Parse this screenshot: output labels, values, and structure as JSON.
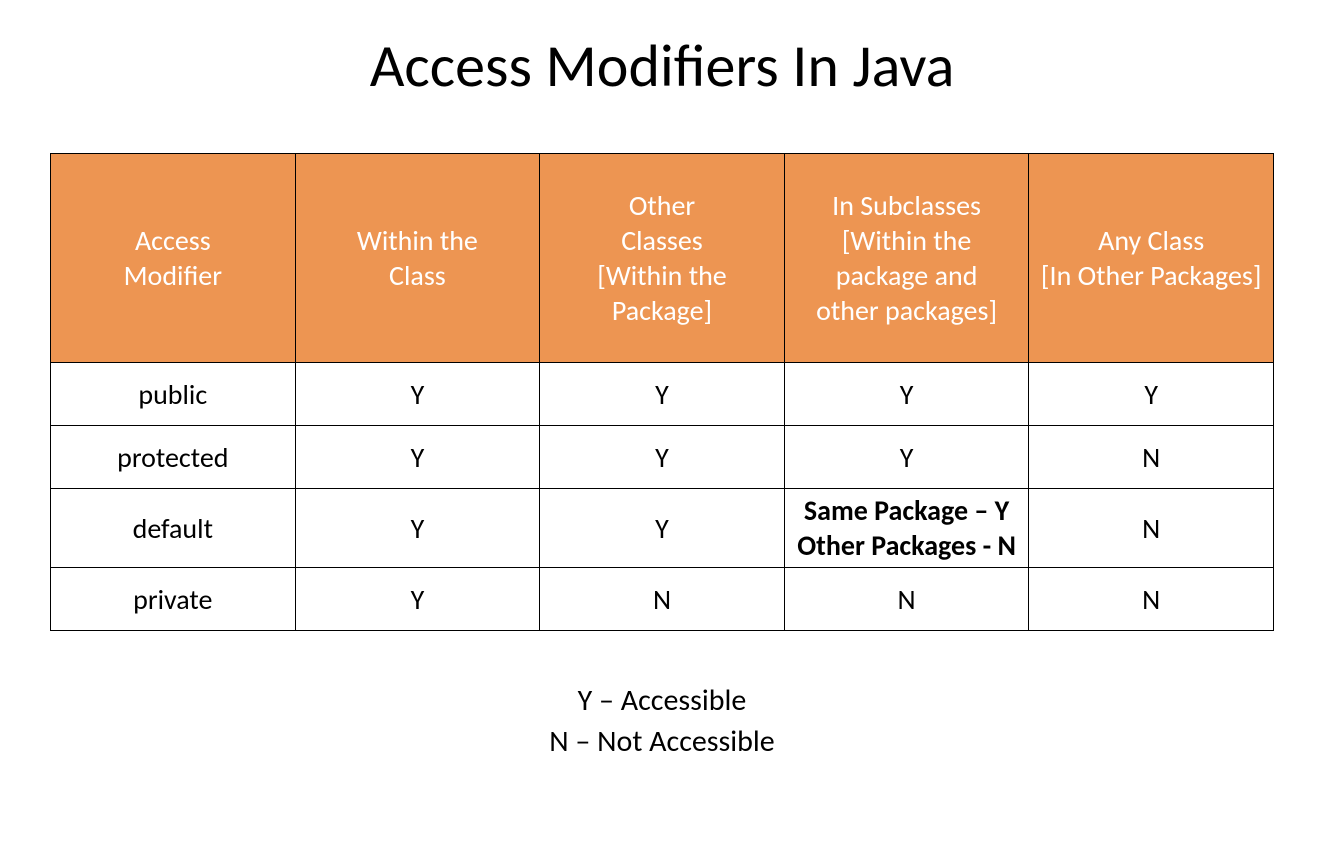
{
  "title": "Access Modifiers In Java",
  "headers": [
    "Access Modifier",
    "Within the Class",
    "Other Classes [Within the Package]",
    "In Subclasses [Within the package and other packages]",
    "Any Class [In Other Packages]"
  ],
  "rows": [
    {
      "name": "public",
      "c1": "Y",
      "c2": "Y",
      "c3": "Y",
      "c4": "Y"
    },
    {
      "name": "protected",
      "c1": "Y",
      "c2": "Y",
      "c3": "Y",
      "c4": "N"
    },
    {
      "name": "default",
      "c1": "Y",
      "c2": "Y",
      "c3_line1": "Same Package – Y",
      "c3_line2": "Other Packages - N",
      "c4": "N"
    },
    {
      "name": "private",
      "c1": "Y",
      "c2": "N",
      "c3": "N",
      "c4": "N"
    }
  ],
  "legend": {
    "y": "Y – Accessible",
    "n": "N – Not Accessible"
  },
  "chart_data": {
    "type": "table",
    "title": "Access Modifiers In Java",
    "columns": [
      "Access Modifier",
      "Within the Class",
      "Other Classes [Within the Package]",
      "In Subclasses [Within the package and other packages]",
      "Any Class [In Other Packages]"
    ],
    "rows": [
      [
        "public",
        "Y",
        "Y",
        "Y",
        "Y"
      ],
      [
        "protected",
        "Y",
        "Y",
        "Y",
        "N"
      ],
      [
        "default",
        "Y",
        "Y",
        "Same Package – Y / Other Packages - N",
        "N"
      ],
      [
        "private",
        "Y",
        "N",
        "N",
        "N"
      ]
    ],
    "legend": {
      "Y": "Accessible",
      "N": "Not Accessible"
    }
  }
}
